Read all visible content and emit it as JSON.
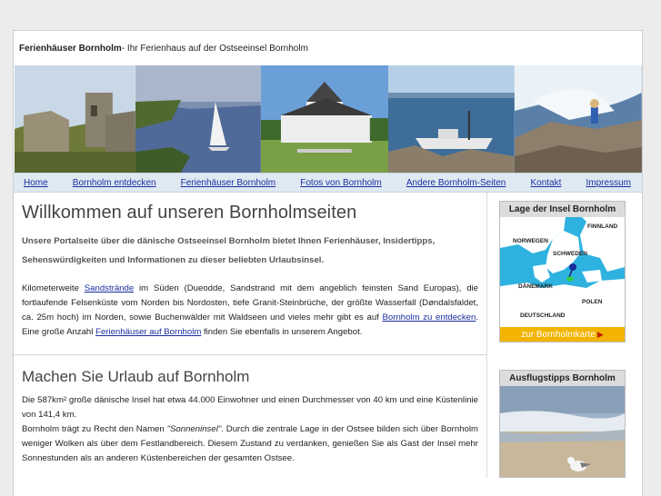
{
  "header": {
    "site_name": "Ferienhäuser Bornholm",
    "tagline": " - Ihr Ferienhaus auf der Ostseeinsel Bornholm"
  },
  "nav": {
    "items": [
      "Home",
      "Bornholm entdecken",
      "Ferienhäuser Bornholm",
      "Fotos von Bornholm",
      "Andere Bornholm-Seiten",
      "Kontakt",
      "Impressum"
    ]
  },
  "section1": {
    "title": "Willkommen auf unseren Bornholmseiten",
    "intro": "Unsere Portalseite über die dänische Ostseeinsel Bornholm bietet Ihnen Ferienhäuser, Insidertipps, Sehenswürdigkeiten und Informationen zu dieser beliebten Urlaubsinsel.",
    "p_1": "Kilometerweite ",
    "link_sand": "Sandstrände",
    "p_2": " im Süden (Dueodde, Sandstrand mit dem angeblich feinsten Sand Europas), die fortlaufende Felsenküste vom Norden bis Nordosten, tiefe Granit-Steinbrüche, der größte Wasserfall (Døndalsfaldet, ca. 25m hoch) im Norden, sowie Buchenwälder mit Waldseen und vieles mehr gibt es auf ",
    "link_entdecken": "Bornholm zu entdecken",
    "p_3": ". Eine große Anzahl ",
    "link_ferien": "Ferienhäuser auf Bornholm",
    "p_4": " finden Sie ebenfalls in unserem Angebot."
  },
  "section2": {
    "title": "Machen Sie Urlaub auf Bornholm",
    "p1": "Die 587km² große dänische Insel hat etwa 44.000 Einwohner und einen Durchmesser von 40 km und eine Küstenlinie von 141,4 km.",
    "p2_a": "Bornholm trägt zu Recht den Namen ",
    "p2_em": "\"Sonneninsel\"",
    "p2_b": ". Durch die zentrale Lage in der Ostsee bilden sich über Bornholm weniger Wolken als über dem Festlandbereich. Diesem Zustand zu verdanken, genießen Sie als Gast der Insel mehr Sonnestunden als an anderen Küstenbereichen der gesamten Ostsee."
  },
  "sidebar": {
    "map_title": "Lage der Insel Bornholm",
    "map_labels": {
      "finnland": "FINNLAND",
      "norwegen": "NORWEGEN",
      "schweden": "SCHWEDEN",
      "daenemark": "DÄNEMARK",
      "polen": "POLEN",
      "deutschland": "DEUTSCHLAND"
    },
    "map_link": "zur Bornholmkarte",
    "tips_title": "Ausflugstipps Bornholm"
  },
  "colors": {
    "nav_bg": "#dfe9f1",
    "link": "#1a2ea0",
    "map_button": "#f2b400",
    "sea": "#2eb2e0"
  },
  "icons": {
    "map_arrow": "triangle-right-icon",
    "map_pin": "map-pin-icon"
  }
}
